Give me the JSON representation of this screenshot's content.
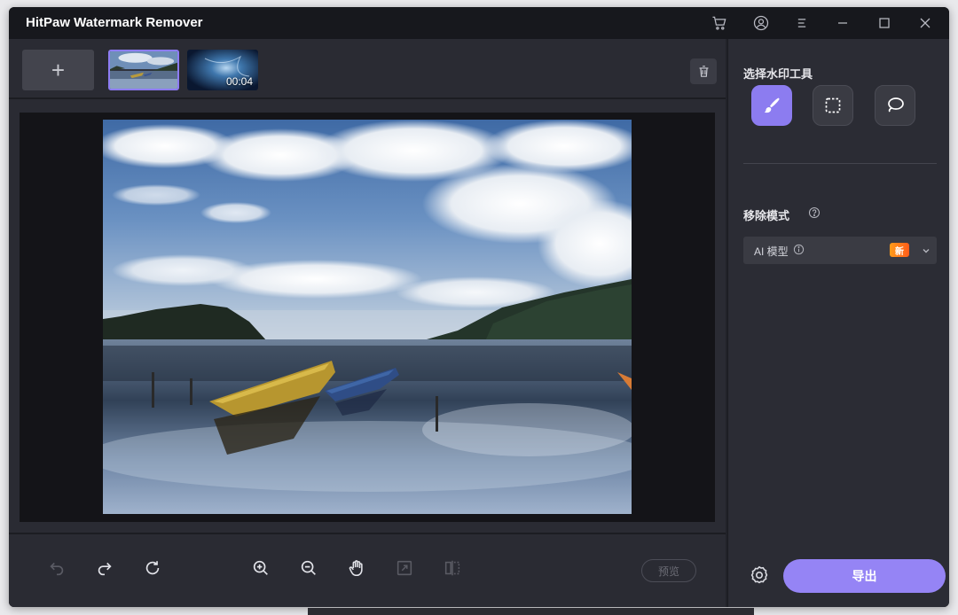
{
  "app": {
    "title": "HitPaw Watermark Remover"
  },
  "media": {
    "add_label": "+",
    "thumbnails": [
      {
        "type": "image",
        "selected": true
      },
      {
        "type": "video",
        "duration": "00:04"
      }
    ]
  },
  "sidebar": {
    "tool_section_title": "选择水印工具",
    "tools": [
      "brush-tool",
      "rectangle-select-tool",
      "lasso-tool"
    ],
    "mode_section_title": "移除模式",
    "mode_selected": "AI 模型",
    "mode_badge": "新"
  },
  "bottom": {
    "preview_label": "预览"
  },
  "actions": {
    "export_label": "导出"
  },
  "colors": {
    "accent": "#8c7cf0",
    "export_button": "#9584f5",
    "badge": "#ff7a1a",
    "panel_bg": "#2b2c34",
    "titlebar_bg": "#17181d"
  }
}
